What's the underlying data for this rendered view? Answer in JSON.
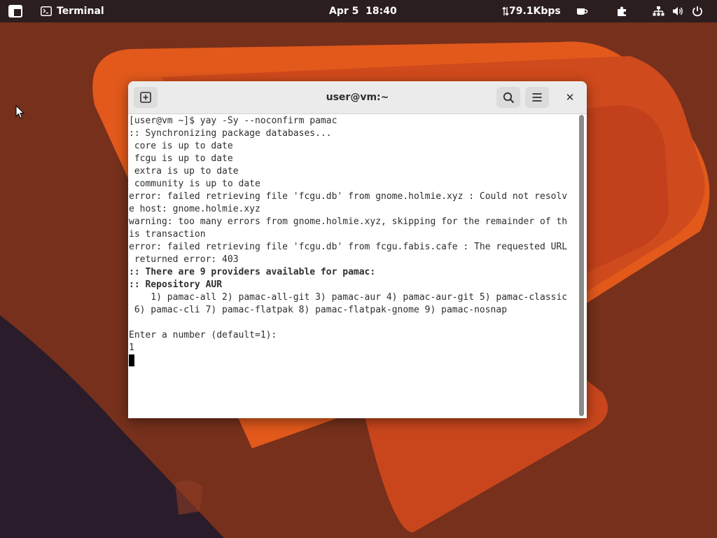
{
  "topbar": {
    "activities_icon": "activities-grid-icon",
    "app_icon": "terminal-icon",
    "app_name": "Terminal",
    "clock": "Apr 5  18:40",
    "net_speed": "79.1Kbps",
    "net_speed_icon": "up-down-arrows-icon",
    "caffeine_icon": "coffee-cup-icon",
    "extensions_icon": "puzzle-piece-icon",
    "tray_icons": [
      "network-wired-icon",
      "volume-icon",
      "power-icon"
    ]
  },
  "window": {
    "title": "user@vm:~",
    "new_tab_icon": "new-tab-icon",
    "search_icon": "search-icon",
    "menu_icon": "hamburger-menu-icon",
    "close_label": "✕"
  },
  "terminal": {
    "lines": [
      "[user@vm ~]$ yay -Sy --noconfirm pamac",
      ":: Synchronizing package databases...",
      " core is up to date",
      " fcgu is up to date",
      " extra is up to date",
      " community is up to date",
      "error: failed retrieving file 'fcgu.db' from gnome.holmie.xyz : Could not resolv",
      "e host: gnome.holmie.xyz",
      "warning: too many errors from gnome.holmie.xyz, skipping for the remainder of th",
      "is transaction",
      "error: failed retrieving file 'fcgu.db' from fcgu.fabis.cafe : The requested URL",
      " returned error: 403",
      ":: There are 9 providers available for pamac:",
      ":: Repository AUR",
      "    1) pamac-all 2) pamac-all-git 3) pamac-aur 4) pamac-aur-git 5) pamac-classic",
      " 6) pamac-cli 7) pamac-flatpak 8) pamac-flatpak-gnome 9) pamac-nosnap",
      "",
      "Enter a number (default=1):",
      "1"
    ]
  },
  "colors": {
    "topbar_bg": "#2b1e1e",
    "wallpaper_base": "#7a2e1a",
    "wallpaper_orange": "#e2591b",
    "header_bg": "#ebebeb"
  }
}
